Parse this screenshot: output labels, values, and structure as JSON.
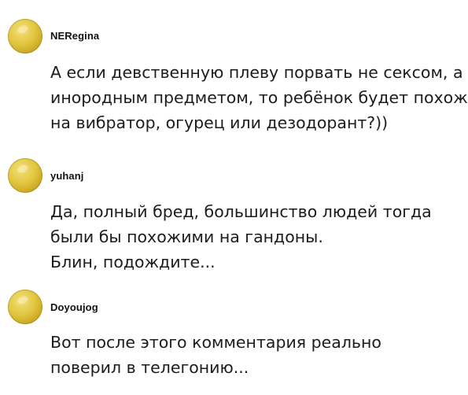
{
  "comments": [
    {
      "username": "NERegina",
      "avatar_icon": "avatar-icon",
      "lines": [
        "А если девственную плеву порвать не сексом, а",
        "инородным предметом, то ребёнок будет похож",
        "на вибратор, огурец или дезодорант?))"
      ]
    },
    {
      "username": "yuhanj",
      "avatar_icon": "avatar-icon",
      "lines": [
        "Да, полный бред, большинство людей тогда",
        "были бы похожими на гандоны.",
        "Блин, подождите..."
      ]
    },
    {
      "username": "Doyoujog",
      "avatar_icon": "avatar-icon",
      "lines": [
        "Вот после этого комментария реально",
        "поверил в телегонию..."
      ]
    }
  ],
  "colors": {
    "background": "#ffffff",
    "text": "#1c1c1c",
    "avatar": "#d9bc36"
  }
}
